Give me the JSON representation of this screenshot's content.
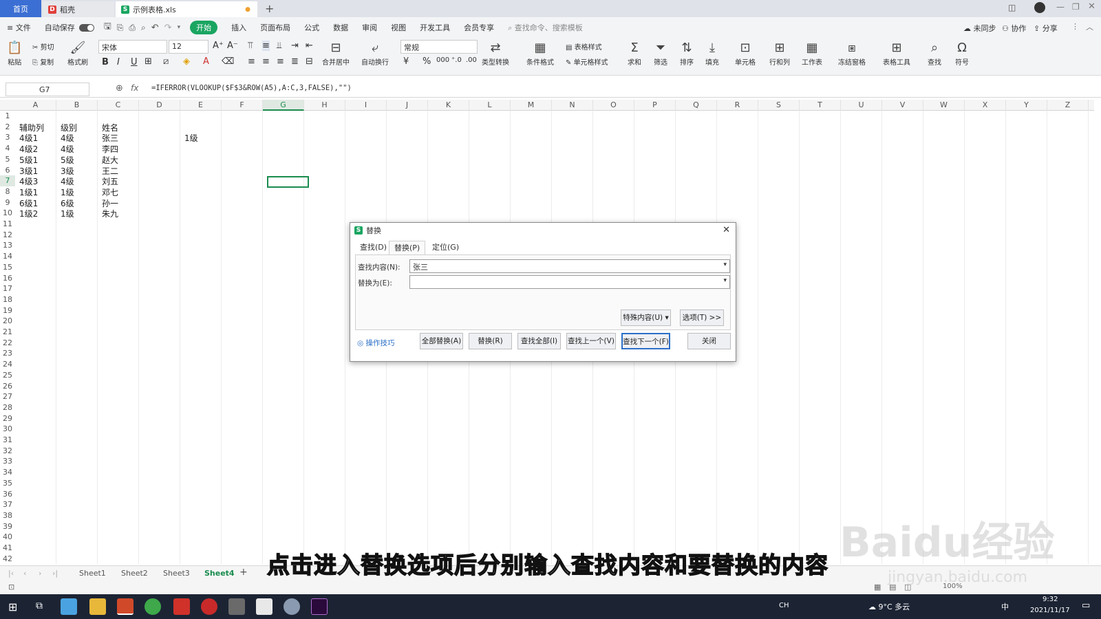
{
  "tabs": {
    "home": "首页",
    "daoke": "稻壳",
    "file": "示例表格.xls"
  },
  "menu": {
    "file": "文件",
    "autosave": "自动保存",
    "items": [
      "开始",
      "插入",
      "页面布局",
      "公式",
      "数据",
      "审阅",
      "视图",
      "开发工具",
      "会员专享"
    ],
    "search_placeholder": "查找命令、搜索模板",
    "unsync": "未同步",
    "collab": "协作",
    "share": "分享"
  },
  "ribbon": {
    "paste": "粘贴",
    "cut": "剪切",
    "copy": "复制",
    "format_painter": "格式刷",
    "font": "宋体",
    "font_size": "12",
    "merge_center": "合并居中",
    "wrap": "自动换行",
    "number_format": "常规",
    "type_convert": "类型转换",
    "cond_format": "条件格式",
    "table_style": "表格样式",
    "cell_style": "单元格样式",
    "sum": "求和",
    "filter": "筛选",
    "sort": "排序",
    "fill": "填充",
    "cell": "单元格",
    "row_col": "行和列",
    "worksheet": "工作表",
    "freeze": "冻结窗格",
    "table_tools": "表格工具",
    "find": "查找",
    "symbol": "符号"
  },
  "formula_bar": {
    "name_box": "G7",
    "fx": "fx",
    "formula": "=IFERROR(VLOOKUP($F$3&ROW(A5),A:C,3,FALSE),\"\")"
  },
  "grid": {
    "columns": [
      "A",
      "B",
      "C",
      "D",
      "E",
      "F",
      "G",
      "H",
      "I",
      "J",
      "K",
      "L",
      "M",
      "N",
      "O",
      "P",
      "Q",
      "R",
      "S",
      "T",
      "U",
      "V",
      "W",
      "X",
      "Y",
      "Z"
    ],
    "rows": [
      "1",
      "2",
      "3",
      "4",
      "5",
      "6",
      "7",
      "8",
      "9",
      "10",
      "11",
      "12",
      "13",
      "14",
      "15",
      "16",
      "17",
      "18",
      "19",
      "20",
      "21",
      "22",
      "23",
      "24",
      "25",
      "26",
      "27",
      "28",
      "29",
      "30",
      "31",
      "32",
      "33",
      "34",
      "35",
      "36",
      "37",
      "38",
      "39",
      "40",
      "41",
      "42"
    ],
    "header": [
      "辅助列",
      "级别",
      "姓名"
    ],
    "data": [
      [
        "4级1",
        "4级",
        "张三"
      ],
      [
        "4级2",
        "4级",
        "李四"
      ],
      [
        "5级1",
        "5级",
        "赵大"
      ],
      [
        "3级1",
        "3级",
        "王二"
      ],
      [
        "4级3",
        "4级",
        "刘五"
      ],
      [
        "1级1",
        "1级",
        "邓七"
      ],
      [
        "6级1",
        "6级",
        "孙一"
      ],
      [
        "1级2",
        "1级",
        "朱九"
      ]
    ],
    "e3": "1级"
  },
  "sheets": [
    "Sheet1",
    "Sheet2",
    "Sheet3",
    "Sheet4"
  ],
  "active_sheet": "Sheet4",
  "dialog": {
    "title": "替换",
    "tabs": [
      "查找(D)",
      "替换(P)",
      "定位(G)"
    ],
    "find_label": "查找内容(N):",
    "find_value": "张三",
    "replace_label": "替换为(E):",
    "replace_value": "",
    "special": "特殊内容(U)",
    "options": "选项(T) >>",
    "tips": "操作技巧",
    "replace_all": "全部替换(A)",
    "replace": "替换(R)",
    "find_all": "查找全部(I)",
    "find_prev": "查找上一个(V)",
    "find_next": "查找下一个(F)",
    "close": "关闭"
  },
  "status": {
    "zoom": "100%"
  },
  "taskbar": {
    "lang": "CH",
    "weather": "9°C 多云",
    "ime": "中",
    "time": "9:32",
    "date": "2021/11/17"
  },
  "overlay": {
    "subtitle": "点击进入替换选项后分别输入查找内容和要替换的内容",
    "watermark": "Baidu经验",
    "watermark_url": "jingyan.baidu.com"
  },
  "colors": {
    "accent_green": "#1aa561",
    "home_tab": "#3b6fd3",
    "selection": "#1a8c4e",
    "taskbar": "#1c2434"
  }
}
